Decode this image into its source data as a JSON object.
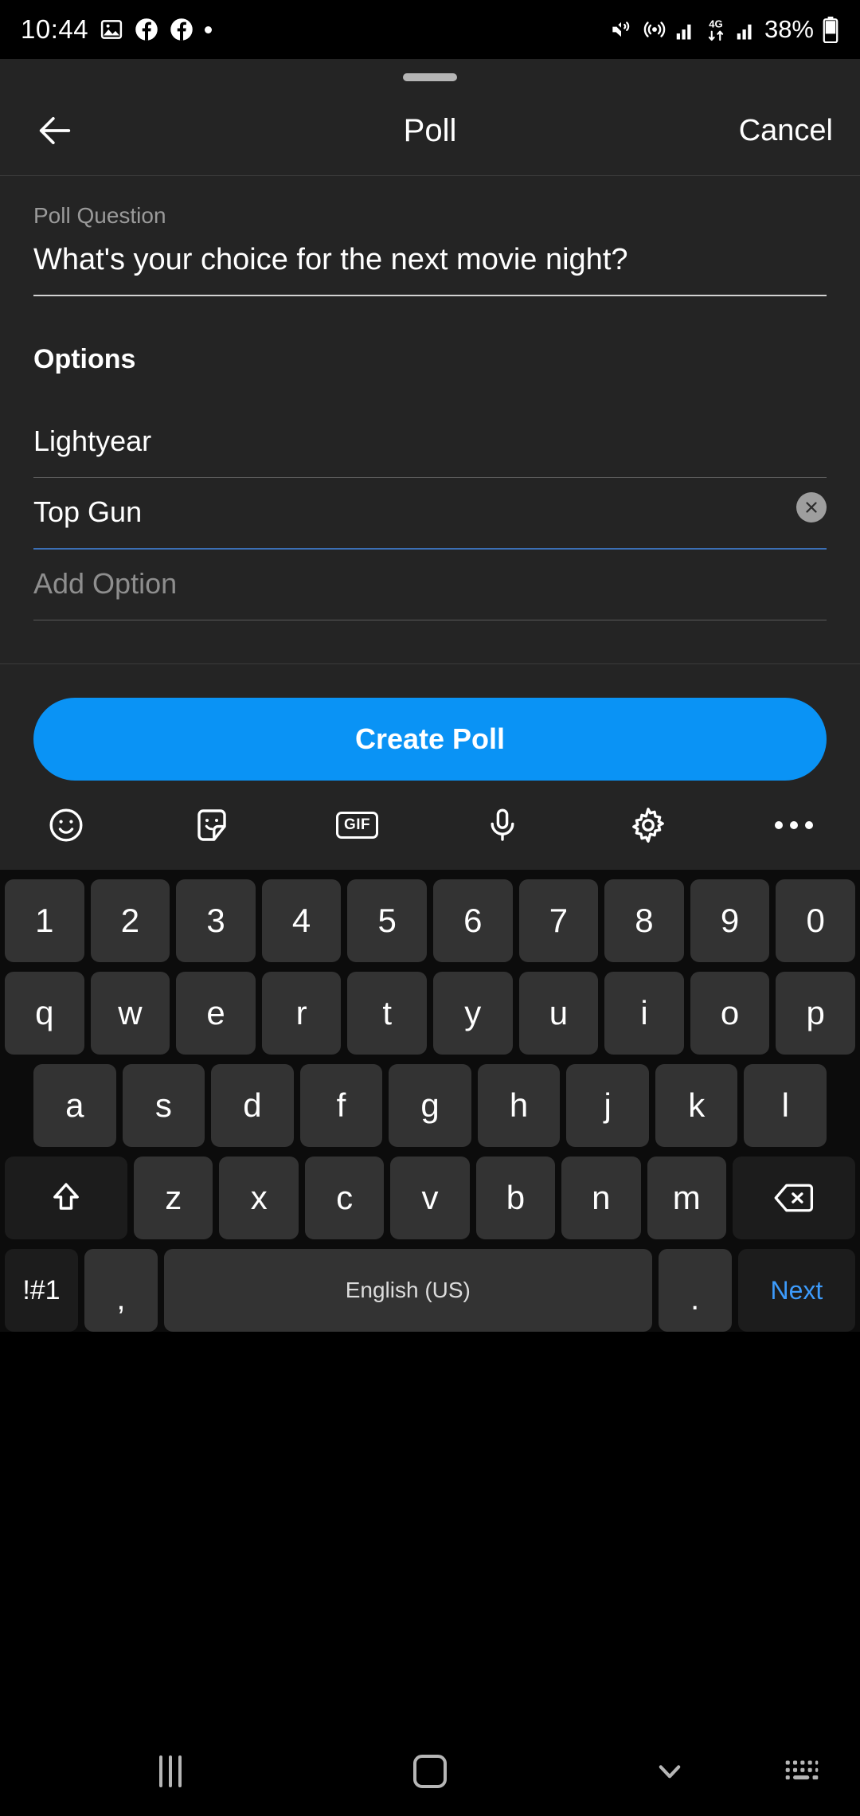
{
  "status_bar": {
    "time": "10:44",
    "left_icons": [
      "image-icon",
      "facebook-icon",
      "facebook-icon",
      "dot-icon"
    ],
    "right_icons": [
      "vibrate-mute-icon",
      "hotspot-icon",
      "signal-bars-icon",
      "network-4g-icon",
      "signal-bars-icon"
    ],
    "network_label": "4G",
    "battery_percent": "38%"
  },
  "header": {
    "back_label": "back-arrow",
    "title": "Poll",
    "cancel_label": "Cancel"
  },
  "form": {
    "question_label": "Poll Question",
    "question_value": "What's your choice for the next movie night?",
    "options_heading": "Options",
    "options": [
      {
        "value": "Lightyear",
        "placeholder": "",
        "focused": false,
        "has_clear": false
      },
      {
        "value": "Top Gun",
        "placeholder": "",
        "focused": true,
        "has_clear": true
      },
      {
        "value": "",
        "placeholder": "Add Option",
        "focused": false,
        "has_clear": false
      }
    ],
    "create_button": "Create Poll",
    "accent_color": "#0a93f5",
    "focus_color": "#3b6fb5"
  },
  "keyboard_toolbar": {
    "items": [
      "emoji-icon",
      "sticker-icon",
      "gif-icon",
      "microphone-icon",
      "gear-icon",
      "more-icon"
    ],
    "gif_label": "GIF"
  },
  "keyboard": {
    "row_numbers": [
      "1",
      "2",
      "3",
      "4",
      "5",
      "6",
      "7",
      "8",
      "9",
      "0"
    ],
    "row_top": [
      "q",
      "w",
      "e",
      "r",
      "t",
      "y",
      "u",
      "i",
      "o",
      "p"
    ],
    "row_home": [
      "a",
      "s",
      "d",
      "f",
      "g",
      "h",
      "j",
      "k",
      "l"
    ],
    "row_bottom": [
      "z",
      "x",
      "c",
      "v",
      "b",
      "n",
      "m"
    ],
    "shift_label": "shift-icon",
    "backspace_label": "backspace-icon",
    "symbols_key": "!#1",
    "comma_key": ",",
    "space_key": "English (US)",
    "period_key": ".",
    "action_key": "Next",
    "action_color": "#3d9bfb"
  },
  "nav_bar": {
    "recents": "recents-icon",
    "home": "home-icon",
    "dismiss_keyboard": "chevron-down-icon",
    "keyboard_switch": "keyboard-switch-icon"
  }
}
